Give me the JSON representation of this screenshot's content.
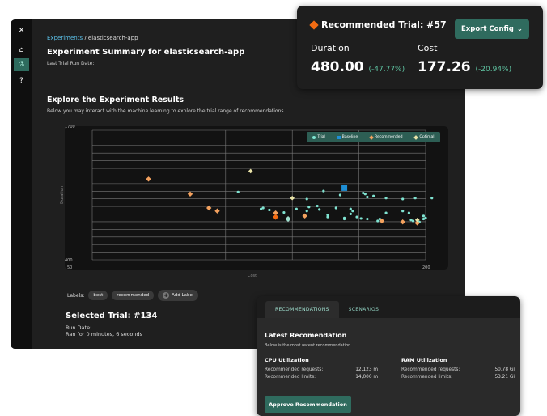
{
  "nav": {
    "icons": [
      "logo-icon",
      "home-icon",
      "experiment-icon",
      "help-icon"
    ]
  },
  "breadcrumb": {
    "parent": "Experiments",
    "separator": "/",
    "current": "elasticsearch-app"
  },
  "summary": {
    "title": "Experiment Summary for elasticsearch-app",
    "last_run_label": "Last Trial Run Date:"
  },
  "explore": {
    "title": "Explore the Experiment Results",
    "description": "Below you may interact with the machine learning to explore the trial range of recommendations."
  },
  "chart_data": {
    "type": "scatter",
    "xlabel": "Cost",
    "ylabel": "Duration",
    "xlim": [
      50,
      200
    ],
    "ylim": [
      400,
      1700
    ],
    "x_ticks": [
      "50",
      "200"
    ],
    "y_ticks": [
      "1700",
      "400"
    ],
    "legend": {
      "placement": "top-right",
      "items": [
        "Trial",
        "Baseline",
        "Recommended",
        "Optimal"
      ]
    },
    "series": [
      {
        "name": "Trial",
        "points": [
          [
            112,
            1080
          ],
          [
            123,
            910
          ],
          [
            124,
            920
          ],
          [
            127,
            900
          ],
          [
            134,
            875
          ],
          [
            140,
            910
          ],
          [
            145,
            1010
          ],
          [
            145,
            890
          ],
          [
            146,
            930
          ],
          [
            150,
            940
          ],
          [
            151,
            905
          ],
          [
            153,
            1090
          ],
          [
            155,
            850
          ],
          [
            155,
            830
          ],
          [
            159,
            920
          ],
          [
            161,
            1050
          ],
          [
            163,
            820
          ],
          [
            163,
            810
          ],
          [
            166,
            910
          ],
          [
            166,
            860
          ],
          [
            167,
            890
          ],
          [
            169,
            830
          ],
          [
            171,
            815
          ],
          [
            172,
            1070
          ],
          [
            173,
            1060
          ],
          [
            174,
            1030
          ],
          [
            174,
            810
          ],
          [
            177,
            1040
          ],
          [
            179,
            790
          ],
          [
            180,
            810
          ],
          [
            183,
            870
          ],
          [
            183,
            1020
          ],
          [
            191,
            1010
          ],
          [
            191,
            890
          ],
          [
            194,
            870
          ],
          [
            195,
            800
          ],
          [
            196,
            790
          ],
          [
            197,
            1020
          ],
          [
            199,
            780
          ],
          [
            201,
            810
          ],
          [
            201,
            840
          ],
          [
            202,
            820
          ],
          [
            205,
            1020
          ]
        ]
      },
      {
        "name": "Baseline",
        "points": [
          [
            163,
            1120
          ]
        ]
      },
      {
        "name": "Recommended",
        "points": [
          [
            69,
            1210
          ],
          [
            89,
            1060
          ],
          [
            98,
            920
          ],
          [
            102,
            890
          ],
          [
            130,
            870
          ],
          [
            144,
            840
          ],
          [
            181,
            790
          ],
          [
            191,
            780
          ],
          [
            198,
            770
          ]
        ]
      },
      {
        "name": "Optimal",
        "points": [
          [
            118,
            1290
          ],
          [
            138,
            1020
          ],
          [
            198,
            800
          ]
        ]
      }
    ],
    "highlight": {
      "recommended": [
        130,
        830
      ],
      "optimal": [
        136,
        810
      ]
    }
  },
  "labels_bar": {
    "label": "Labels:",
    "pills": [
      "best",
      "recommended"
    ],
    "add": "Add Label"
  },
  "selected": {
    "title": "Selected Trial: #134",
    "run_date": "Run Date:",
    "ran_for": "Ran for 0 minutes, 6 seconds"
  },
  "rec_card": {
    "title": "Recommended Trial: #57",
    "button": "Export Config",
    "duration_label": "Duration",
    "duration_value": "480.00",
    "duration_change": "(-47.77%)",
    "cost_label": "Cost",
    "cost_value": "177.26",
    "cost_change": "(-20.94%)",
    "accent": "#f26b12"
  },
  "recommendations": {
    "tabs": [
      "RECOMMENDATIONS",
      "SCENARIOS"
    ],
    "title": "Latest Recomendation",
    "subtitle": "Below is the most recent recommendation.",
    "cpu": {
      "title": "CPU Utilization",
      "requests_label": "Recommended requests:",
      "requests_value": "12,123 m",
      "limits_label": "Recommended limits:",
      "limits_value": "14,000 m"
    },
    "ram": {
      "title": "RAM Utilization",
      "requests_label": "Recommended requests:",
      "requests_value": "50.78 Gi",
      "limits_label": "Recommended limits:",
      "limits_value": "53.21 Gi"
    },
    "approve": "Approve Recommendation"
  }
}
